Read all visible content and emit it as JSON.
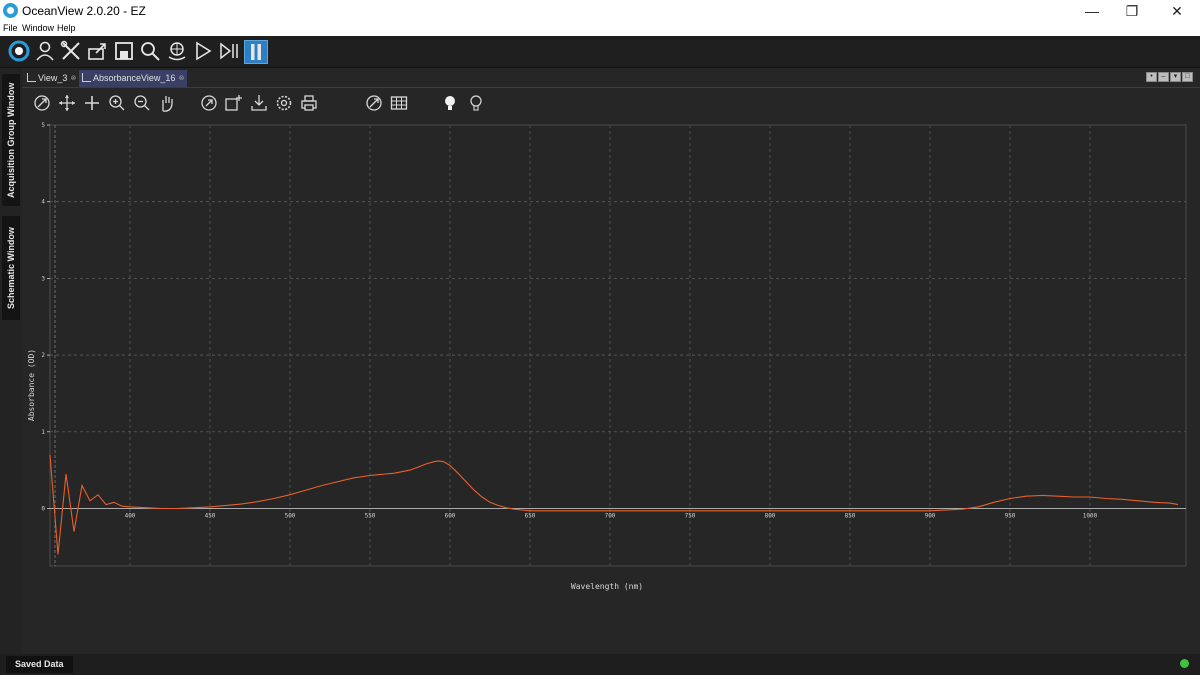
{
  "app": {
    "title": "OceanView 2.0.20  - EZ",
    "icon": "oceanview-logo"
  },
  "window_controls": [
    "minimize-icon",
    "restore-icon",
    "close-icon"
  ],
  "menu": [
    "File",
    "Window",
    "Help"
  ],
  "toolbar": {
    "icons": [
      "oceanview-icon",
      "user-icon",
      "tools-icon",
      "export-icon",
      "save-icon",
      "search-icon",
      "globe-hands-icon",
      "play-icon",
      "step-icon",
      "pause-icon"
    ],
    "active": "pause-icon",
    "accent": "#2c7fc4"
  },
  "sidebar": {
    "tabs": [
      "Acquisition Group Window",
      "Schematic Window"
    ]
  },
  "view_tabs": [
    {
      "label": "View_3",
      "active": false
    },
    {
      "label": "AbsorbanceView_16",
      "active": true
    }
  ],
  "plot_toolbar": {
    "icons": [
      "autoscale-icon",
      "pan-all-icon",
      "pan-icon",
      "zoom-in-icon",
      "zoom-out-icon",
      "hand-icon",
      "refresh-icon",
      "add-chart-icon",
      "download-icon",
      "settings-icon",
      "print-icon",
      "scale-icon",
      "table-icon",
      "bulb-on-icon",
      "bulb-off-icon"
    ]
  },
  "chart_data": {
    "type": "line",
    "xlabel": "Wavelength (nm)",
    "ylabel": "Absorbance (OD)",
    "xlim": [
      350,
      1060
    ],
    "ylim": [
      -0.75,
      5.0
    ],
    "x_ticks": [
      400,
      450,
      500,
      550,
      600,
      650,
      700,
      750,
      800,
      850,
      900,
      950,
      1000
    ],
    "y_ticks": [
      0,
      1,
      2,
      3,
      4,
      5
    ],
    "grid": true,
    "line_color": "#e8602a",
    "series": [
      {
        "x": [
          350,
          355,
          360,
          365,
          370,
          375,
          380,
          385,
          390,
          395,
          400,
          410,
          420,
          430,
          440,
          450,
          460,
          470,
          480,
          490,
          500,
          510,
          520,
          530,
          540,
          550,
          555,
          560,
          565,
          570,
          575,
          580,
          585,
          590,
          593,
          596,
          600,
          605,
          610,
          615,
          620,
          625,
          630,
          635,
          640,
          645,
          650,
          660,
          680,
          700,
          750,
          800,
          850,
          900,
          920,
          930,
          940,
          950,
          960,
          970,
          980,
          990,
          1000,
          1010,
          1020,
          1030,
          1040,
          1050,
          1055
        ],
        "y": [
          0.7,
          -0.6,
          0.45,
          -0.3,
          0.3,
          0.1,
          0.18,
          0.05,
          0.08,
          0.03,
          0.02,
          0.01,
          0.0,
          0.0,
          0.01,
          0.02,
          0.04,
          0.06,
          0.09,
          0.13,
          0.18,
          0.24,
          0.3,
          0.35,
          0.4,
          0.43,
          0.44,
          0.45,
          0.46,
          0.48,
          0.5,
          0.54,
          0.58,
          0.61,
          0.62,
          0.61,
          0.56,
          0.46,
          0.35,
          0.24,
          0.15,
          0.08,
          0.04,
          0.01,
          -0.01,
          -0.02,
          -0.03,
          -0.03,
          -0.03,
          -0.03,
          -0.03,
          -0.03,
          -0.03,
          -0.03,
          -0.01,
          0.02,
          0.08,
          0.13,
          0.16,
          0.17,
          0.16,
          0.15,
          0.15,
          0.13,
          0.12,
          0.1,
          0.08,
          0.07,
          0.05
        ]
      }
    ]
  },
  "status": {
    "saved_data_label": "Saved Data",
    "indicator_color": "#3cc43c"
  }
}
